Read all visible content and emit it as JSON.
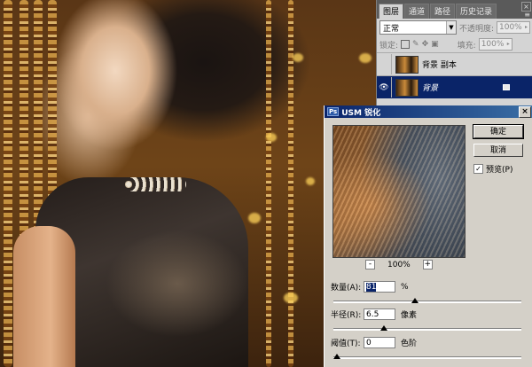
{
  "layers_panel": {
    "tabs": [
      "图层",
      "通道",
      "路径",
      "历史记录"
    ],
    "active_tab": 0,
    "blend_mode": "正常",
    "opacity_label": "不透明度:",
    "opacity_value": "100%",
    "lock_label": "锁定:",
    "fill_label": "填充:",
    "fill_value": "100%",
    "layers": [
      {
        "name": "背景 副本",
        "visible": false,
        "selected": false
      },
      {
        "name": "背景",
        "visible": true,
        "selected": true
      }
    ]
  },
  "sharpen_dialog": {
    "title": "USM 锐化",
    "ok_label": "确定",
    "cancel_label": "取消",
    "preview_label": "预览(P)",
    "preview_checked": true,
    "zoom_value": "100%",
    "params": [
      {
        "label": "数量(A):",
        "value": "81",
        "unit": "%",
        "slider_fraction": 0.43
      },
      {
        "label": "半径(R):",
        "value": "6.5",
        "unit": "像素",
        "slider_fraction": 0.26
      },
      {
        "label": "阈值(T):",
        "value": "0",
        "unit": "色阶",
        "slider_fraction": 0.0
      }
    ]
  }
}
